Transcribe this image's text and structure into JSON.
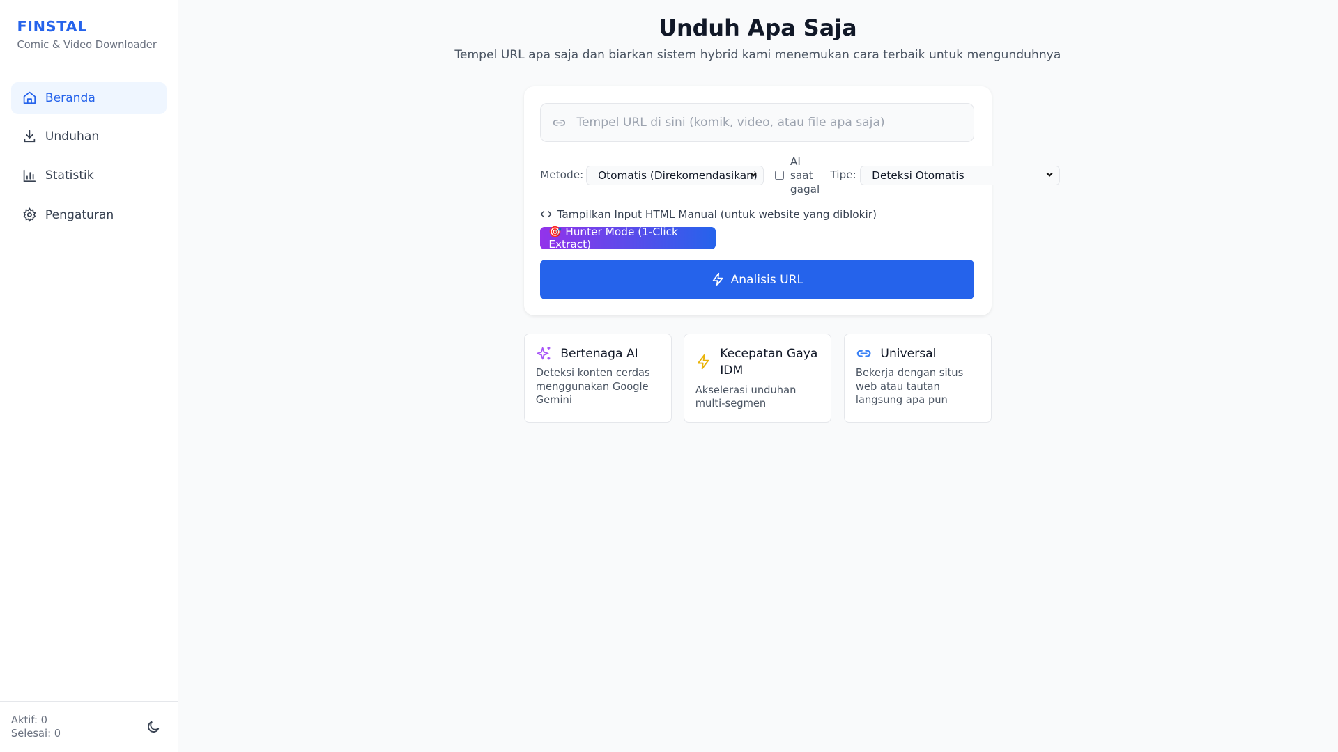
{
  "sidebar": {
    "brand": "FINSTAL",
    "subtitle": "Comic & Video Downloader",
    "items": [
      {
        "label": "Beranda",
        "icon": "home-icon"
      },
      {
        "label": "Unduhan",
        "icon": "download-icon"
      },
      {
        "label": "Statistik",
        "icon": "bar-chart-icon"
      },
      {
        "label": "Pengaturan",
        "icon": "gear-icon"
      }
    ],
    "active_label": "Aktif: 0",
    "done_label": "Selesai: 0"
  },
  "main": {
    "title": "Unduh Apa Saja",
    "subtitle": "Tempel URL apa saja dan biarkan sistem hybrid kami menemukan cara terbaik untuk mengunduhnya",
    "url_placeholder": "Tempel URL di sini (komik, video, atau file apa saja)",
    "method_label": "Metode:",
    "method_value": "Otomatis (Direkomendasikan)",
    "ai_fallback": [
      "AI",
      "saat",
      "gagal"
    ],
    "type_label": "Tipe:",
    "type_value": "Deteksi Otomatis",
    "manual_html": "Tampilkan Input HTML Manual (untuk website yang diblokir)",
    "hunter": "🎯 Hunter Mode (1-Click Extract)",
    "analyze": "Analisis URL",
    "features": [
      {
        "title": "Bertenaga AI",
        "desc": "Deteksi konten cerdas menggunakan Google Gemini"
      },
      {
        "title": "Kecepatan Gaya IDM",
        "desc": "Akselerasi unduhan multi-segmen"
      },
      {
        "title": "Universal",
        "desc": "Bekerja dengan situs web atau tautan langsung apa pun"
      }
    ]
  },
  "colors": {
    "accent": "#2563eb",
    "purple": "#9333ea",
    "amber": "#eab308"
  }
}
